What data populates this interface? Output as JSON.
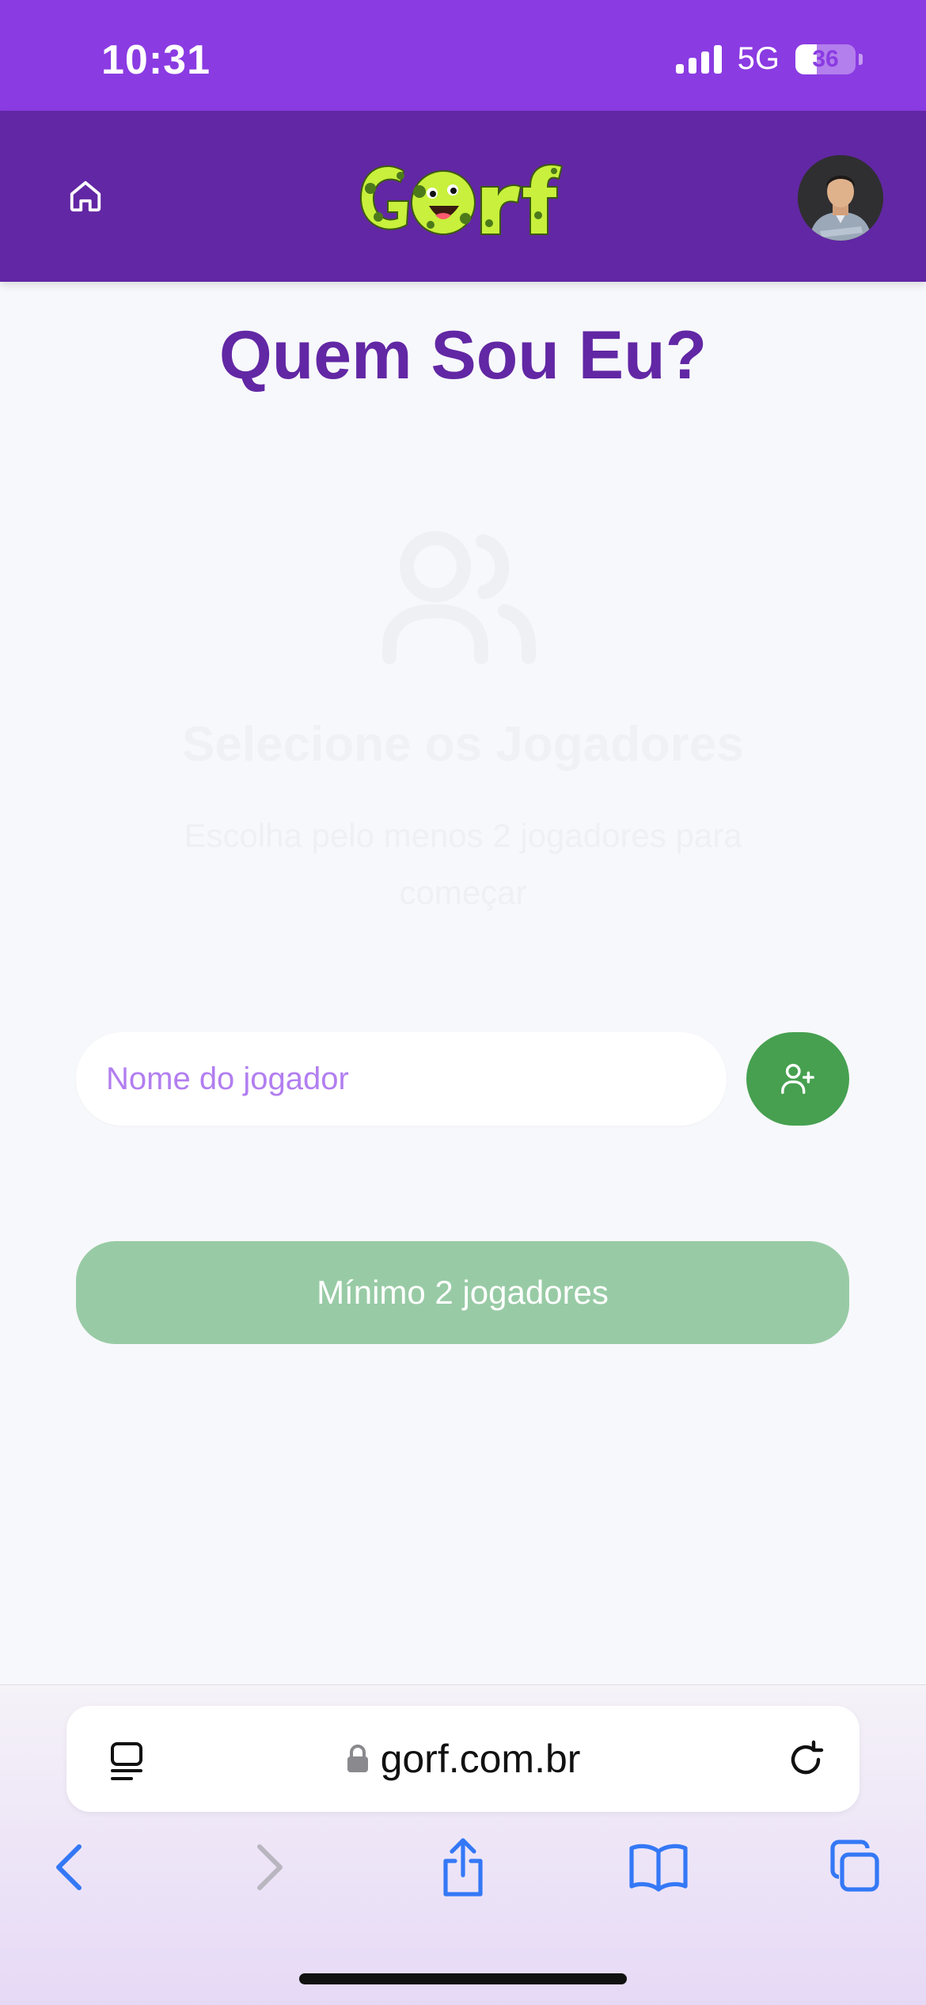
{
  "status_bar": {
    "time": "10:31",
    "network": "5G",
    "battery": "36",
    "battery_level": 0.36
  },
  "header": {
    "logo_text": "Gorf"
  },
  "page": {
    "title": "Quem Sou Eu?"
  },
  "empty_state": {
    "icon": "users-icon",
    "title": "Selecione os Jogadores",
    "subtitle": "Escolha pelo menos 2 jogadores para começar"
  },
  "player_form": {
    "placeholder": "Nome do jogador",
    "value": ""
  },
  "start_button": {
    "label": "Mínimo 2 jogadores"
  },
  "browser": {
    "url": "gorf.com.br"
  },
  "colors": {
    "status_bar": "#8a3be2",
    "header": "#6227a4",
    "accent_green": "#46a050",
    "disabled_green": "#98cba5",
    "logo_green": "#c8f03c"
  }
}
